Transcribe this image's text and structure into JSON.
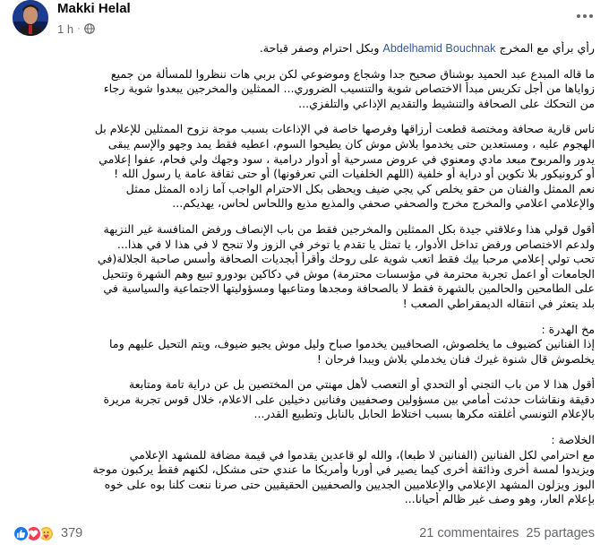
{
  "post": {
    "author": "Makki Helal",
    "time": "1 h",
    "privacy_icon": "globe-icon",
    "mention": "Abdelhamid Bouchnak",
    "intro_before": "رأي برأي مع المخرج",
    "intro_after": "وبكل احترام وصفر قباحة.",
    "lines": [
      "ما قاله المبدع عبد الحميد بوشناق صحيح جدا وشجاع وموضوعي لكن بربي هات ننظروا للمسألة من جميع",
      "زواياها من أجل تكريس مبدأ الاختصاص شوية والتنسيب الضروري... الممثلين والمخرجين يبعدوا شوية رجاء",
      "من التحكك على الصحافة والتنشيط والتقديم الإذاعي والتلفزي...",
      "ناس قارية صحافة ومختصة قطعت أرزاقها وفرصها خاصة في الإذاعات بسبب موجة نزوح الممثلين للإعلام بل",
      "الهجوم عليه ، ومستعدين حتى يخدموا بلاش موش كان يطيحوا السوم، اعطيه فقط يمد وجهو والإسم يبقى",
      "يدور والمربوح مبعد مادي ومعنوي في عروض مسرحية أو أدوار درامية ، سود وجهك ولي فحام، عفوا إعلامي",
      "أو كرونيكور بلا تكوين أو دراية أو خلفية (اللهم الخلفيات التي تعرفونها) أو حتى ثقافة عامة يا رسول الله  !",
      "نعم الممثل والفنان من حقو يخلص كي يجي ضيف ويحظى بكل الاحترام الواجب آما زاده الممثل ممثل",
      "والإعلامي اعلامي والمخرج مخرج  والصحفي صحفي والمذيع مذيع واللحاس لحاس، يهديكم...",
      "أقول قولي هذا وعلاقتي جيدة بكل الممثلين والمخرجين فقط من باب الإنصاف ورفض المنافسة غير النزيهة",
      "ولدعم الاختصاص ورفض تداخل الأدوار، يا تمثل يا تقدم يا توخر في الزوز  ولا تنجح لا في هذا لا في هذا...",
      "تحب تولي إعلامي مرحبا بيك فقط اتعب شوية على روحك وأقرأ أبجديات الصحافة وأسس صاحبة الجلالة(في",
      "الجامعات أو اعمل تجربة محترمة في مؤسسات محترمة) موش في دكاكين بودورو تبيع وهم الشهرة وتتحيل",
      "على الطامحين والحالمين بالشهرة فقط لا بالصحافة ومجدها ومتاعبها ومسؤوليتها الاجتماعية والسياسية في",
      "بلد يتعثر في انتقاله الديمقراطي الصعب  !",
      "مخ الهدرة :",
      "إذا الفنانين كضيوف ما يخلصوش، الصحافيين يخدموا صباح وليل موش يجيو ضيوف، ويتم التحيل عليهم وما",
      "يخلصوش قال شنوة غيرك فنان يخدملي بلاش ويبدا فرحان  !",
      "أقول هذا لا من باب التجني أو التحدي أو التعصب لأهل مهنتي من المختصين  بل عن دراية تامة ومتابعة",
      "دقيقة ونقاشات حدثت أمامي بين مسؤولين وصحفيين وفنانين دخيلين على الاعلام، خلال قوس تجربة مريرة",
      "بالإعلام التونسي أغلقته مكرها بسبب اختلاط الحابل بالنابل وتطبيع القدر...",
      "الخلاصة :",
      "مع احترامي لكل الفنانين (الفنانين لا طبعا)، والله لو قاعدين يقدموا في قيمة مضافة للمشهد الإعلامي",
      "ويزيدوا لمسة أخرى وذائقة أخرى كيما يصير في أوربا وأمريكا ما عندي حتى مشكل، لكنهم فقط يركبون موجة",
      "البوز ويزلون المشهد الإعلامي والإعلاميين الجديين والصحفيين الحقيقيين حتى صرنا ننعت كلنا بوه على خوه",
      "بإعلام العار، وهو وصف غير ظالم أحيانا..."
    ],
    "paragraph_breaks_after": [
      2,
      8,
      14,
      17,
      20
    ]
  },
  "reactions": {
    "count": "379",
    "types": [
      "like",
      "love",
      "care"
    ]
  },
  "stats": {
    "comments": "21 commentaires",
    "shares": "25 partages"
  },
  "colors": {
    "like": "#1877f2",
    "love": "#f33e58",
    "care": "#f7b125",
    "mention": "#385898",
    "secondary_text": "#65676b"
  }
}
